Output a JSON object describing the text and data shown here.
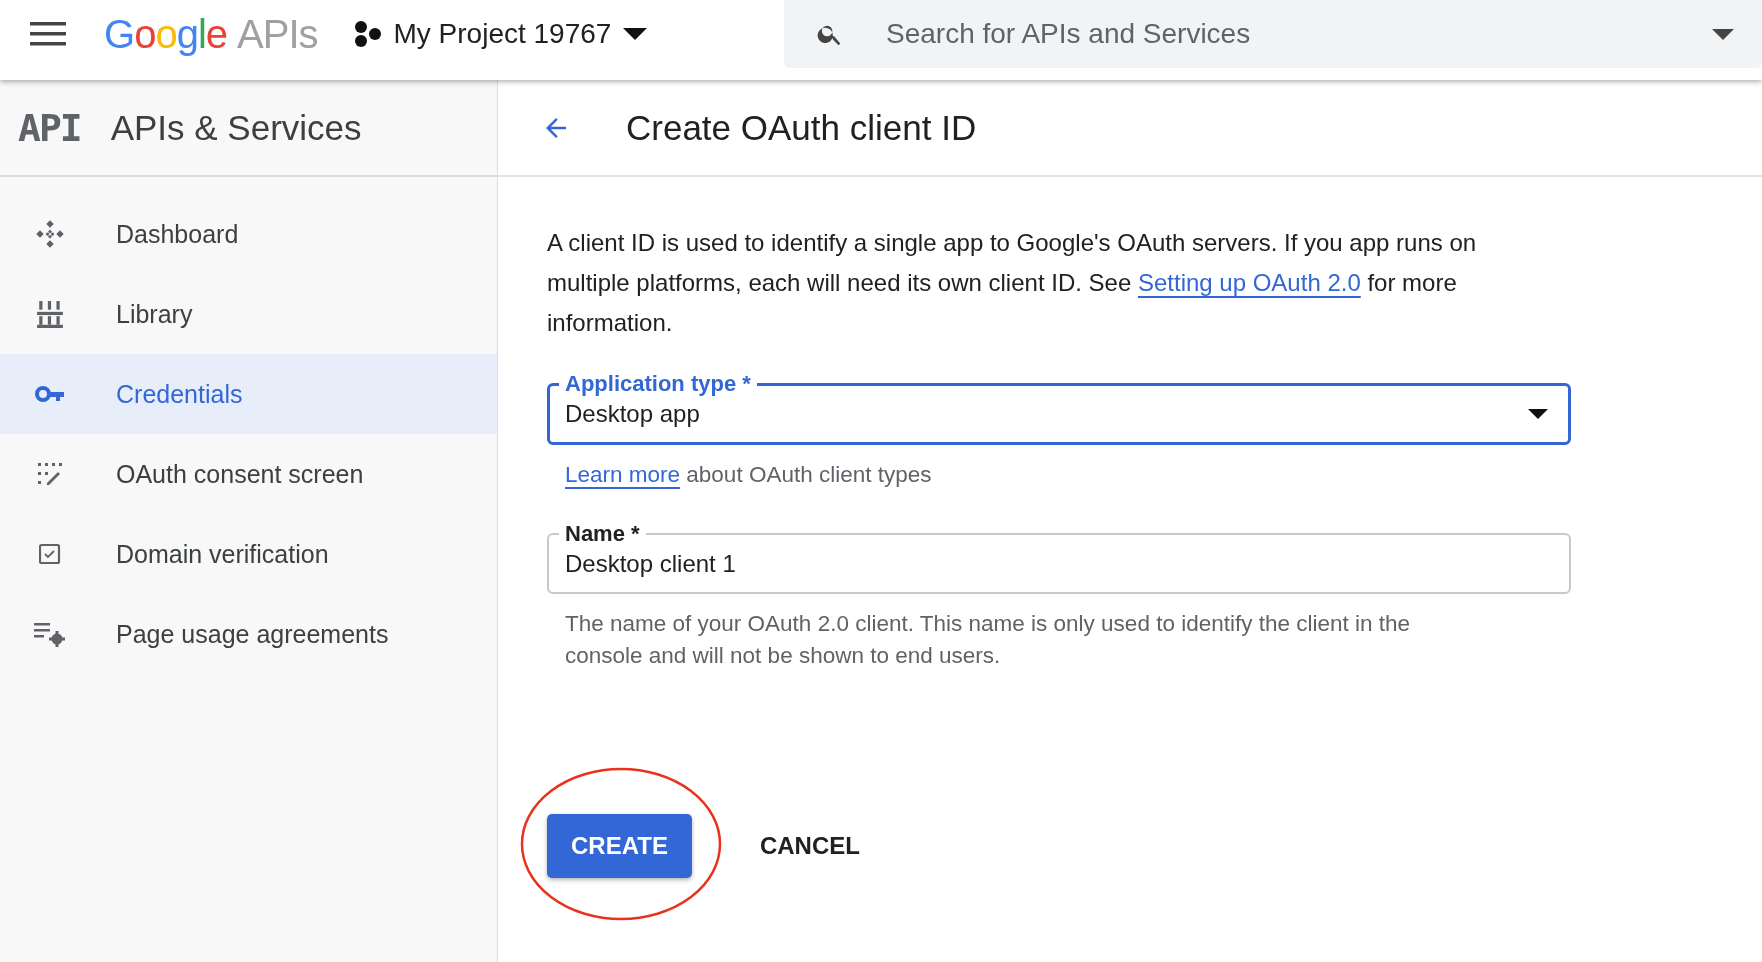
{
  "topbar": {
    "logo": {
      "brand": "Google",
      "product": "APIs"
    },
    "project": {
      "name": "My Project 19767"
    },
    "search": {
      "placeholder": "Search for APIs and Services"
    }
  },
  "sidebar": {
    "logo": "API",
    "title": "APIs & Services",
    "items": [
      {
        "label": "Dashboard",
        "selected": false
      },
      {
        "label": "Library",
        "selected": false
      },
      {
        "label": "Credentials",
        "selected": true
      },
      {
        "label": "OAuth consent screen",
        "selected": false
      },
      {
        "label": "Domain verification",
        "selected": false
      },
      {
        "label": "Page usage agreements",
        "selected": false
      }
    ]
  },
  "page": {
    "title": "Create OAuth client ID",
    "intro_before": "A client ID is used to identify a single app to Google's OAuth servers. If you app runs on multiple platforms, each will need its own client ID. See ",
    "intro_link": "Setting up OAuth 2.0",
    "intro_after": " for more information."
  },
  "form": {
    "fields": [
      {
        "kind": "select",
        "label": "Application type *",
        "value": "Desktop app",
        "focused": true,
        "help_link": "Learn more",
        "help": "about OAuth client types"
      },
      {
        "kind": "text",
        "label": "Name *",
        "value": "Desktop client 1",
        "focused": false,
        "help": "The name of your OAuth 2.0 client. This name is only used to identify the client in the console and will not be shown to end users."
      }
    ]
  },
  "actions": [
    {
      "kind": "primary",
      "label": "CREATE",
      "circled": true
    },
    {
      "kind": "text",
      "label": "CANCEL",
      "circled": false
    }
  ]
}
